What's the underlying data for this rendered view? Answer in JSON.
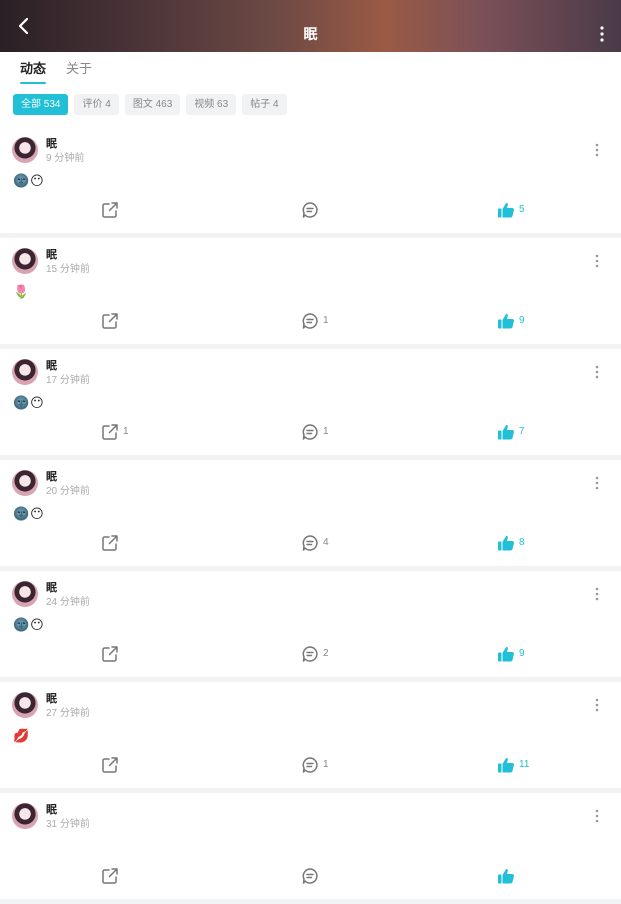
{
  "header": {
    "title": "眠",
    "back_icon": "chevron-left-icon",
    "more_icon": "more-vertical-icon"
  },
  "tabs": [
    {
      "label": "动态",
      "active": true
    },
    {
      "label": "关于",
      "active": false
    }
  ],
  "filters": [
    {
      "label": "全部 534",
      "active": true
    },
    {
      "label": "评价 4",
      "active": false
    },
    {
      "label": "图文 463",
      "active": false
    },
    {
      "label": "视频 63",
      "active": false
    },
    {
      "label": "帖子 4",
      "active": false
    }
  ],
  "colors": {
    "accent": "#21c0d6",
    "divider": "#f2f3f5",
    "chip_bg": "#f1f2f4"
  },
  "posts": [
    {
      "user": "眠",
      "time": "9 分钟前",
      "content": "🌚😶",
      "share": "",
      "comment": "",
      "like": "5"
    },
    {
      "user": "眠",
      "time": "15 分钟前",
      "content": "🌷",
      "share": "",
      "comment": "1",
      "like": "9"
    },
    {
      "user": "眠",
      "time": "17 分钟前",
      "content": "🌚😶",
      "share": "1",
      "comment": "1",
      "like": "7"
    },
    {
      "user": "眠",
      "time": "20 分钟前",
      "content": "🌚😶",
      "share": "",
      "comment": "4",
      "like": "8"
    },
    {
      "user": "眠",
      "time": "24 分钟前",
      "content": "🌚😶",
      "share": "",
      "comment": "2",
      "like": "9"
    },
    {
      "user": "眠",
      "time": "27 分钟前",
      "content": "💋",
      "share": "",
      "comment": "1",
      "like": "11"
    },
    {
      "user": "眠",
      "time": "31 分钟前",
      "content": "",
      "share": "",
      "comment": "",
      "like": ""
    }
  ]
}
